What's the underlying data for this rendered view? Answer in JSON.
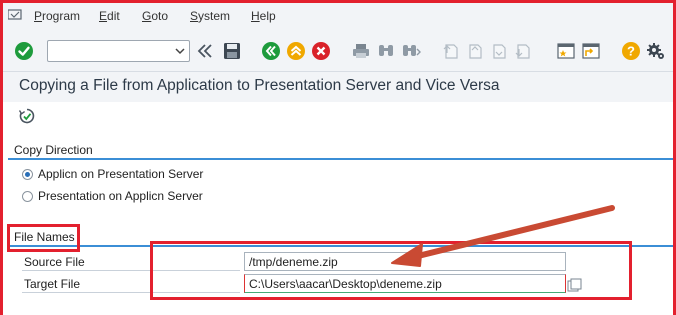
{
  "menu": {
    "items": [
      {
        "label": "Program",
        "key": "P"
      },
      {
        "label": "Edit",
        "key": "E"
      },
      {
        "label": "Goto",
        "key": "G"
      },
      {
        "label": "System",
        "key": "S"
      },
      {
        "label": "Help",
        "key": "H"
      }
    ]
  },
  "toolbar": {
    "command_field_value": "",
    "icons": [
      "enter-icon",
      "dropdown-icon",
      "collapse-icon",
      "save-icon",
      "back-icon",
      "exit-icon",
      "cancel-icon",
      "print-icon",
      "find-icon",
      "find-next-icon",
      "first-page-icon",
      "previous-page-icon",
      "next-page-icon",
      "last-page-icon",
      "new-session-icon",
      "shortcut-icon",
      "help-icon",
      "settings-icon"
    ],
    "colors": {
      "enter": "#1e9b3c",
      "back": "#1e9b3c",
      "exit": "#f0a800",
      "cancel": "#d9222a",
      "help": "#f0a800"
    }
  },
  "page": {
    "title": "Copying a File from Application to Presentation Server and Vice Versa"
  },
  "app_toolbar": {
    "execute_icon": "execute-icon"
  },
  "copy_direction": {
    "header": "Copy Direction",
    "options": [
      {
        "label": "Applicn on Presentation Server",
        "selected": true
      },
      {
        "label": "Presentation on Applicn Server",
        "selected": false
      }
    ]
  },
  "file_names": {
    "header": "File Names",
    "source": {
      "label": "Source File",
      "value": "/tmp/deneme.zip"
    },
    "target": {
      "label": "Target File",
      "value": "C:\\Users\\aacar\\Desktop\\deneme.zip"
    }
  },
  "annotation": {
    "color": "#e3202e",
    "arrow_color": "#c94a33"
  }
}
